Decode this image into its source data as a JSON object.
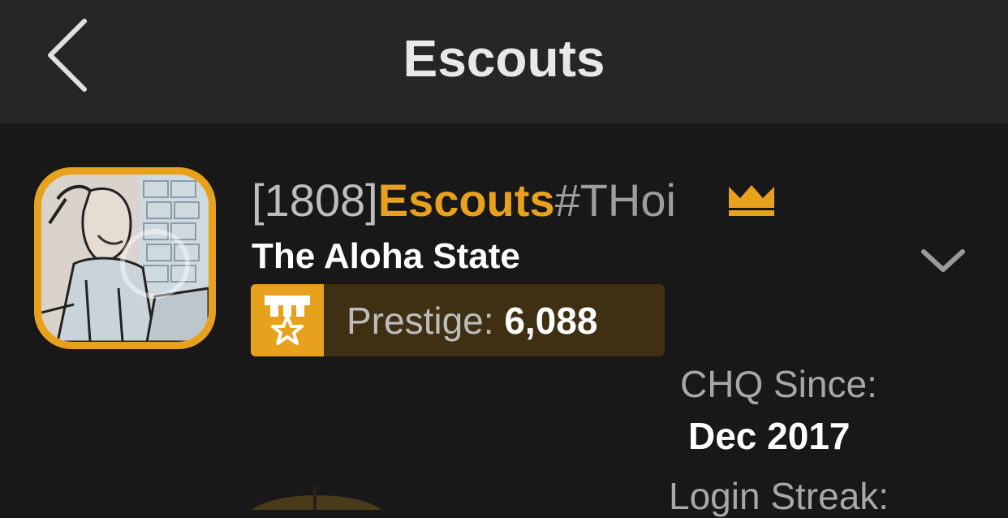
{
  "header": {
    "title": "Escouts"
  },
  "profile": {
    "level": "[1808]",
    "username": "Escouts",
    "tag": "#THoi",
    "state": "The Aloha State",
    "prestige_label": "Prestige:",
    "prestige_value": "6,088",
    "chq_since_label": "CHQ Since:",
    "chq_since_value": "Dec 2017",
    "login_streak_label": "Login Streak:"
  },
  "icons": {
    "back": "chevron-left-icon",
    "crown": "crown-icon",
    "expand": "chevron-down-icon",
    "prestige": "medal-star-icon"
  },
  "colors": {
    "accent": "#e8a11c",
    "header_bg": "#262626",
    "page_bg": "#181818",
    "prestige_bg": "#3f3013"
  }
}
